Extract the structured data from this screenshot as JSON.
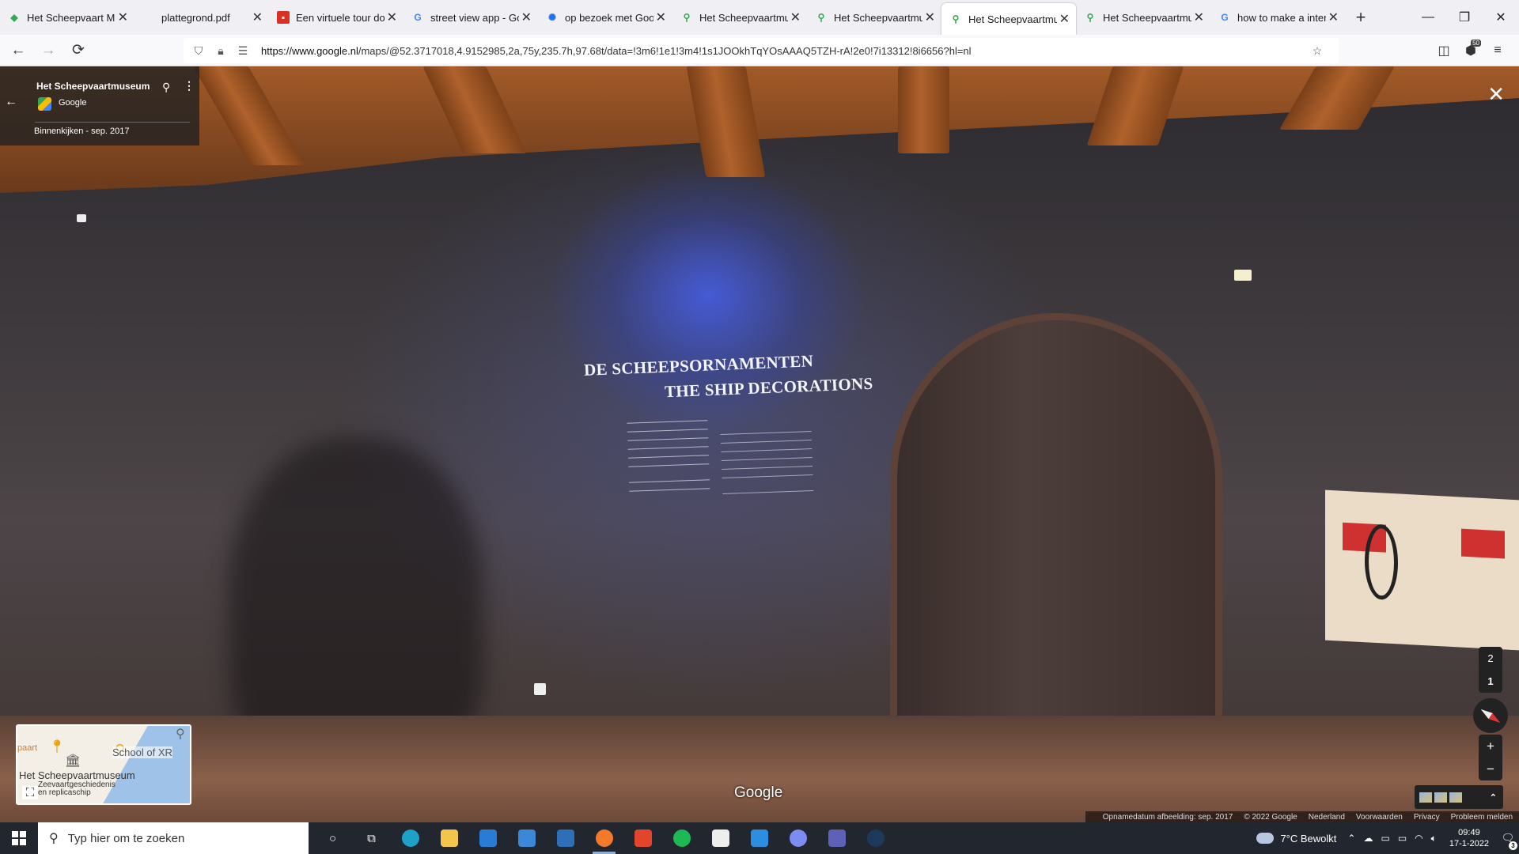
{
  "browser": {
    "tabs": [
      {
        "title": "Het Scheepvaart Muse",
        "favicon": "google-maps-icon",
        "active": false
      },
      {
        "title": "plattegrond.pdf",
        "favicon": "pdf-icon",
        "active": false
      },
      {
        "title": "Een virtuele tour door",
        "favicon": "red-icon",
        "active": false
      },
      {
        "title": "street view app - Goo",
        "favicon": "google-icon",
        "active": false
      },
      {
        "title": "op bezoek met Googl",
        "favicon": "globe-icon",
        "active": false
      },
      {
        "title": "Het Scheepvaartmus",
        "favicon": "google-maps-pin-icon",
        "active": false
      },
      {
        "title": "Het Scheepvaartmus",
        "favicon": "google-maps-pin-icon",
        "active": false
      },
      {
        "title": "Het Scheepvaartmus",
        "favicon": "google-maps-pin-icon",
        "active": true
      },
      {
        "title": "Het Scheepvaartmus",
        "favicon": "google-maps-pin-icon",
        "active": false
      },
      {
        "title": "how to make a intera",
        "favicon": "google-icon",
        "active": false
      }
    ],
    "url_host": "https://www.google.nl",
    "url_path": "/maps/@52.3717018,4.9152985,2a,75y,235.7h,97.68t/data=!3m6!1e1!3m4!1s1JOOkhTqYOsAAAQ5TZH-rA!2e0!7i13312!8i6656?hl=nl",
    "extension_badge": "50"
  },
  "streetview": {
    "place_name": "Het Scheepvaartmuseum",
    "provider": "Google",
    "capture_date": "Binnenkijken - sep. 2017",
    "wall_title_nl": "DE SCHEEPSORNAMENTEN",
    "wall_title_en": "THE SHIP DECORATIONS",
    "floors": [
      "2",
      "1"
    ],
    "active_floor": "1",
    "watermark": "Google",
    "minimap": {
      "labels": {
        "school": "School of XR",
        "museum": "Het Scheepvaartmuseum",
        "sub_line1": "Zeevaartgeschiedenis",
        "sub_line2": "en replicaschip",
        "partial": "paart"
      }
    },
    "footer": {
      "date": "Opnamedatum afbeelding: sep. 2017",
      "copyright": "© 2022 Google",
      "country": "Nederland",
      "terms": "Voorwaarden",
      "privacy": "Privacy",
      "report": "Probleem melden"
    }
  },
  "taskbar": {
    "search_placeholder": "Typ hier om te zoeken",
    "weather": "7°C  Bewolkt",
    "time": "09:49",
    "date": "17-1-2022",
    "notification_count": "3"
  }
}
